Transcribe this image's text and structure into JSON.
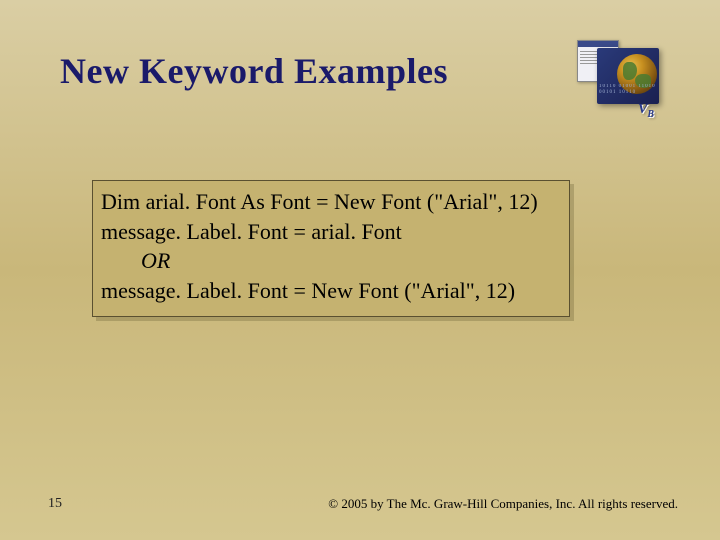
{
  "title": "New Keyword Examples",
  "code": {
    "line1": "Dim arial. Font As Font = New Font (\"Arial\", 12)",
    "line2": "message. Label. Font = arial. Font",
    "or": "OR",
    "line3": "message. Label. Font =  New Font (\"Arial\", 12)"
  },
  "pageNumber": "15",
  "copyright": "© 2005 by The Mc. Graw-Hill Companies, Inc. All rights reserved."
}
